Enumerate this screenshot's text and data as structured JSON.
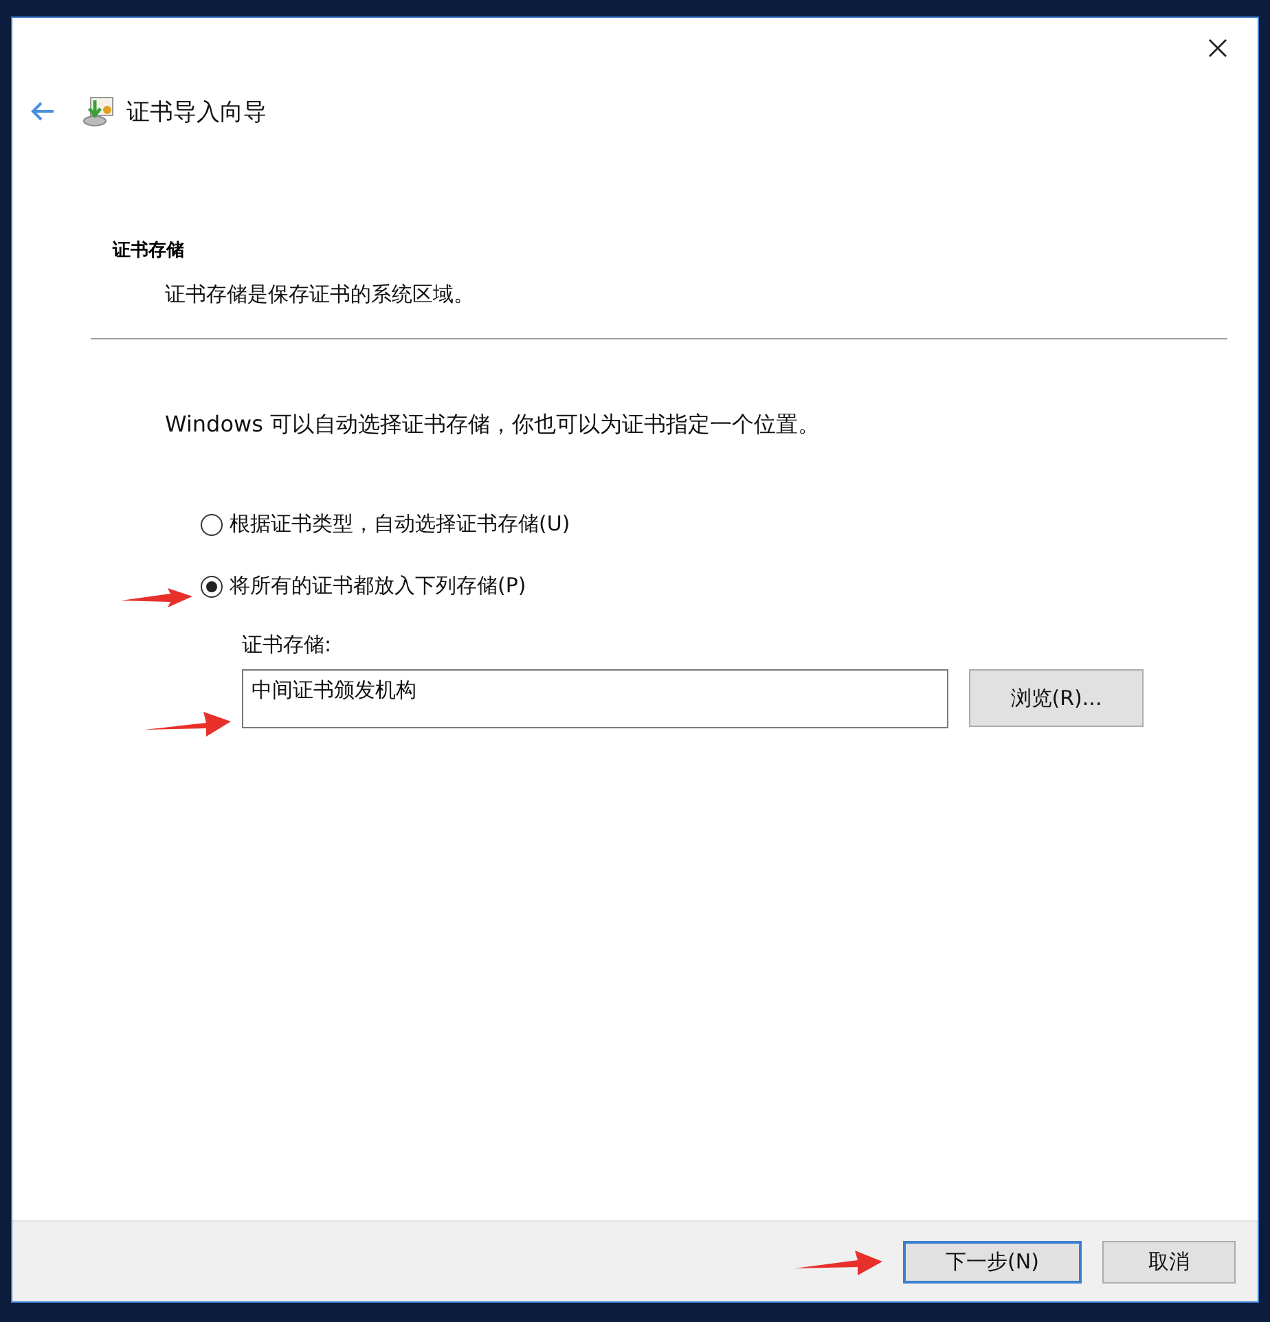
{
  "window": {
    "title": "证书导入向导"
  },
  "header": {
    "title": "证书存储",
    "subtitle": "证书存储是保存证书的系统区域。"
  },
  "intro": "Windows 可以自动选择证书存储，你也可以为证书指定一个位置。",
  "options": [
    {
      "label": "根据证书类型，自动选择证书存储(U)",
      "selected": false
    },
    {
      "label": "将所有的证书都放入下列存储(P)",
      "selected": true
    }
  ],
  "store_field": {
    "label": "证书存储:",
    "value": "中间证书颁发机构"
  },
  "browse_button": "浏览(R)...",
  "buttons": [
    {
      "label": "下一步(N)",
      "default": true
    },
    {
      "label": "取消",
      "default": false
    }
  ]
}
